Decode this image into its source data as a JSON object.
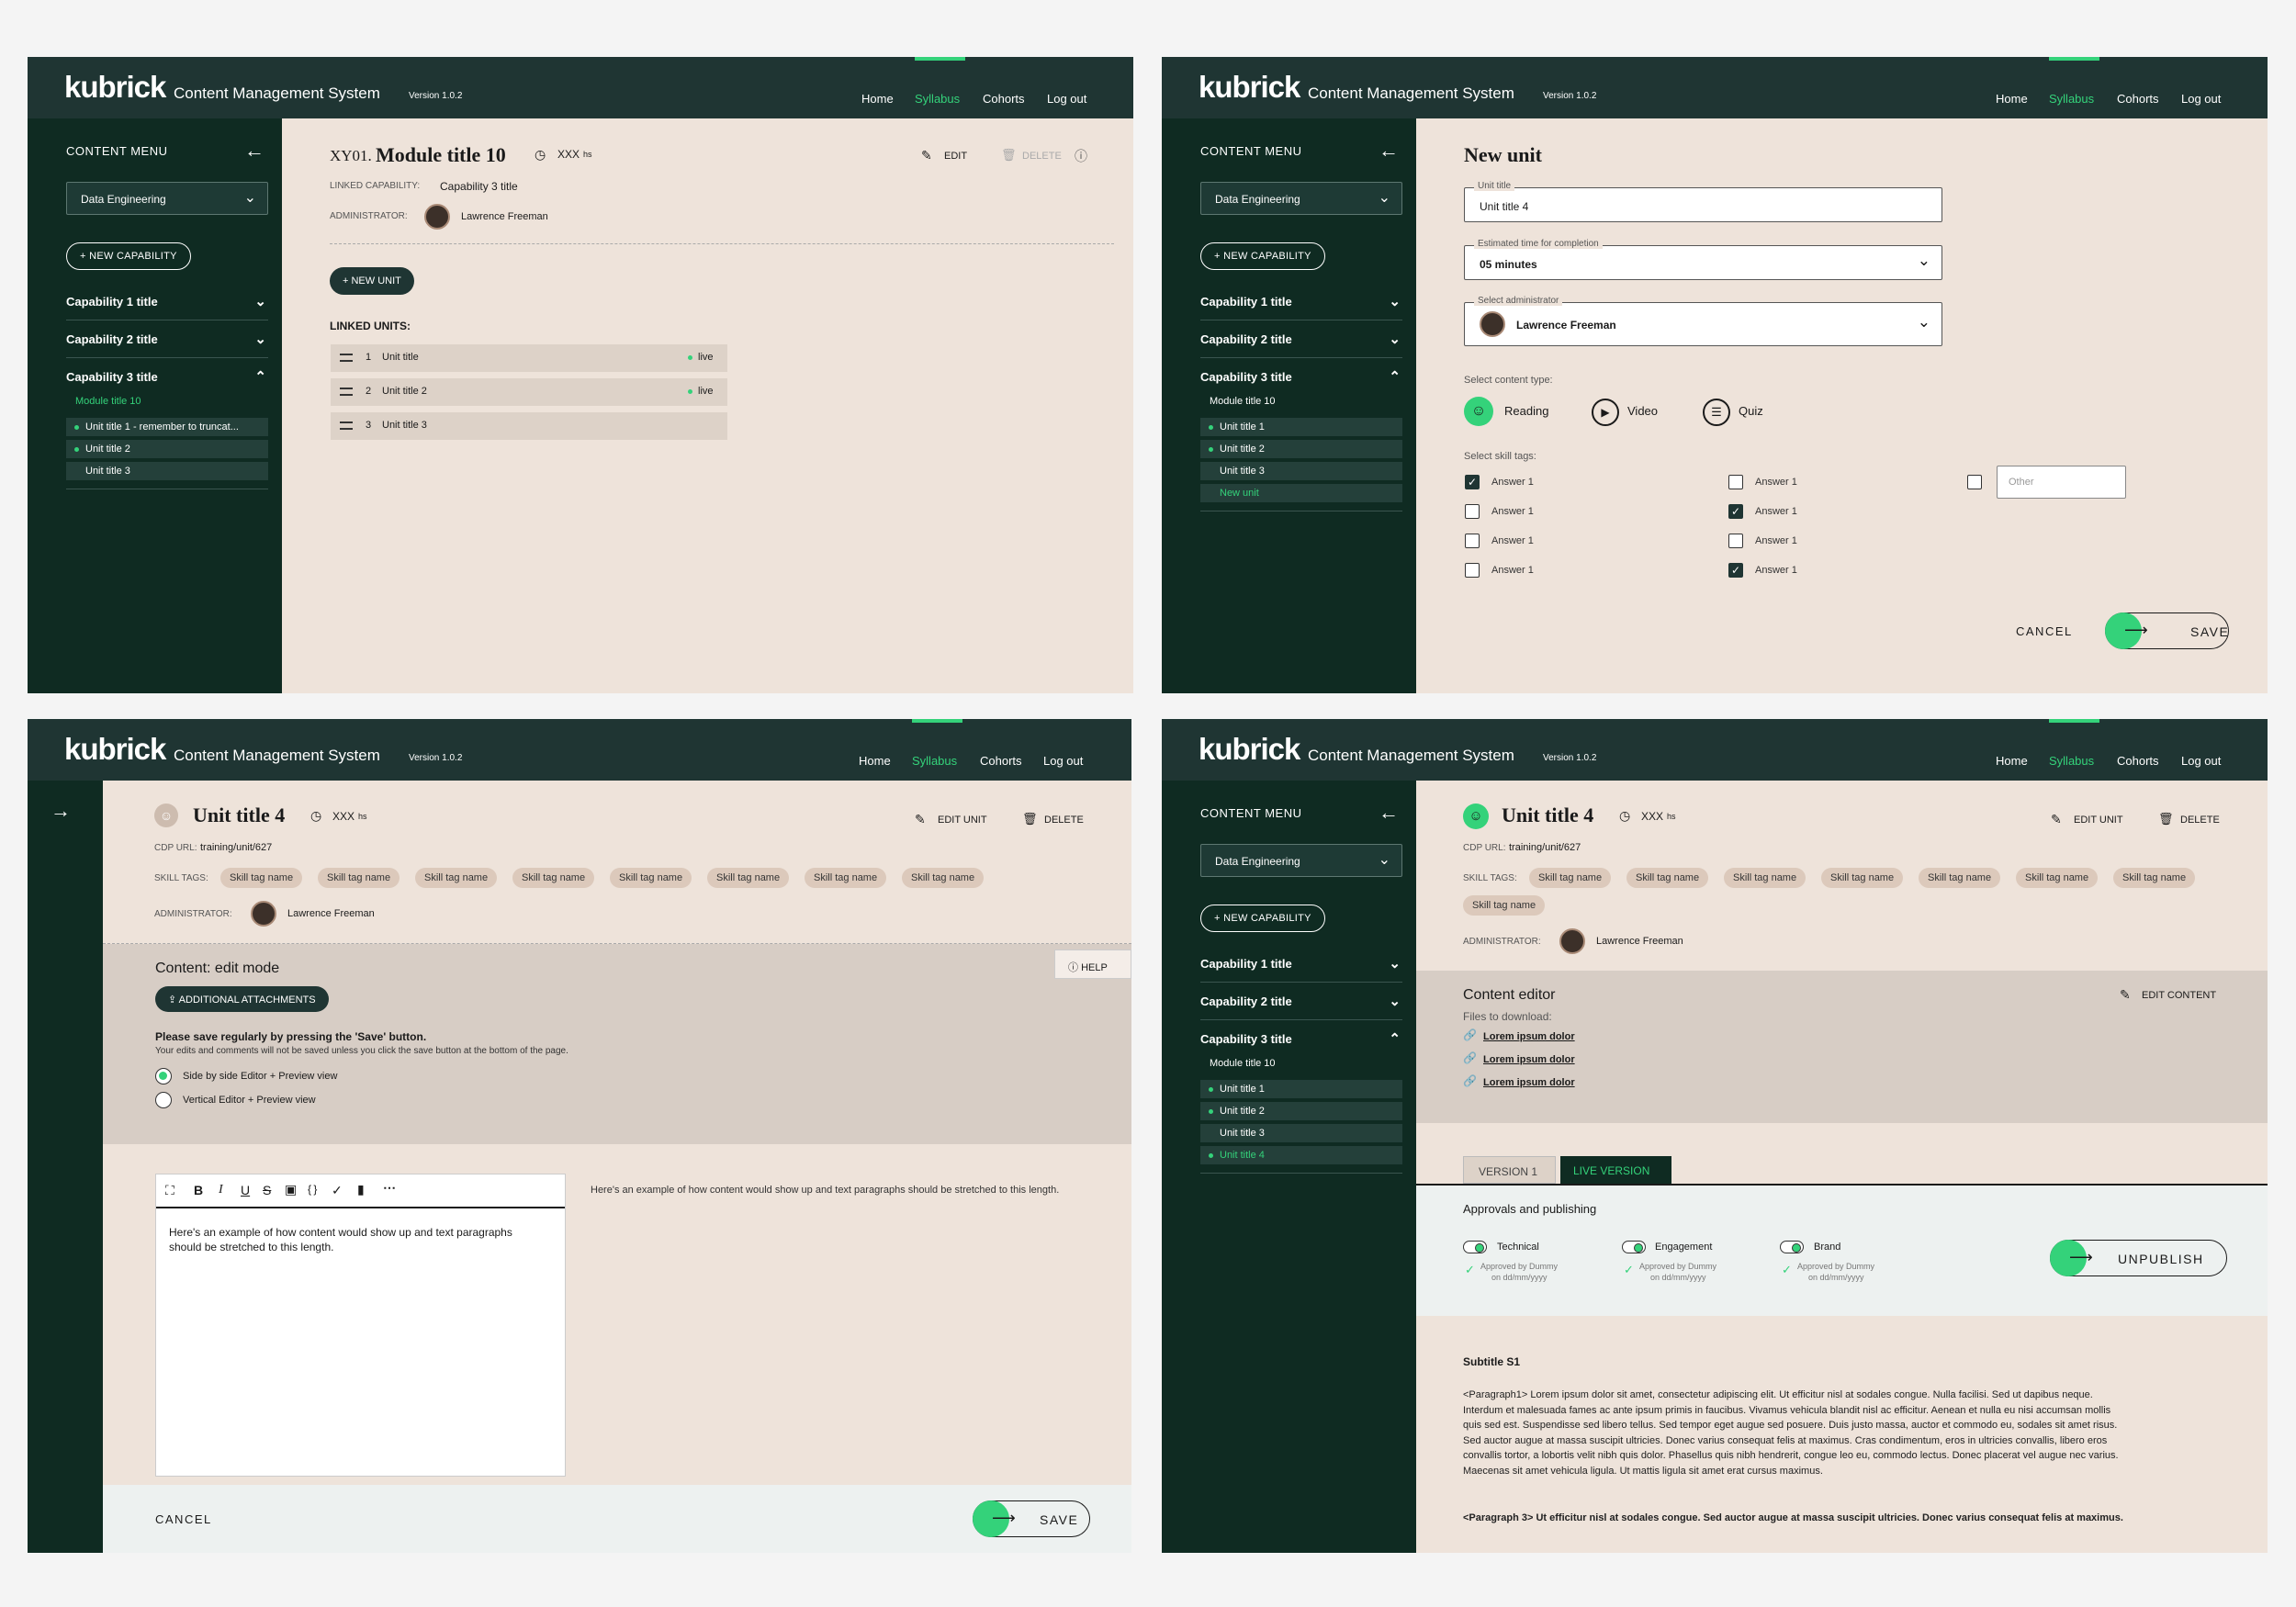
{
  "app": {
    "logo": "kubrick",
    "title": "Content Management System",
    "version": "Version 1.0.2",
    "nav": [
      "Home",
      "Syllabus",
      "Cohorts",
      "Log out"
    ],
    "accent": "#34d27a",
    "header_bg": "#1f3533",
    "sidebar_bg": "#0f2b22",
    "content_bg": "#eee3da"
  },
  "sidebar": {
    "menu_label": "CONTENT MENU",
    "dropdown_value": "Data Engineering",
    "new_capability": "NEW CAPABILITY",
    "capabilities": [
      "Capability 1 title",
      "Capability 2 title",
      "Capability 3 title"
    ]
  },
  "screen1": {
    "module_code": "XY01.",
    "module_title": "Module title 10",
    "duration": "XXX",
    "duration_unit": "hs",
    "edit": "EDIT",
    "delete": "DELETE",
    "linked_capability_label": "LINKED CAPABILITY:",
    "linked_capability": "Capability 3 title",
    "administrator_label": "ADMINISTRATOR:",
    "administrator": "Lawrence Freeman",
    "new_unit": "NEW UNIT",
    "linked_units_label": "LINKED UNITS:",
    "units": [
      {
        "num": "1",
        "title": "Unit title",
        "status": "live"
      },
      {
        "num": "2",
        "title": "Unit title 2",
        "status": "live"
      },
      {
        "num": "3",
        "title": "Unit title 3",
        "status": ""
      }
    ],
    "side_module": "Module title 10",
    "side_units": [
      "Unit title 1 - remember to truncat...",
      "Unit title 2",
      "Unit title 3"
    ]
  },
  "screen2": {
    "heading": "New unit",
    "unit_title_label": "Unit title",
    "unit_title_value": "Unit title 4",
    "time_label": "Estimated time for completion",
    "time_value": "05 minutes",
    "admin_label": "Select administrator",
    "admin_value": "Lawrence Freeman",
    "content_type_label": "Select content type:",
    "content_types": [
      "Reading",
      "Video",
      "Quiz"
    ],
    "skill_tags_label": "Select skill tags:",
    "answers_col1": [
      {
        "label": "Answer 1",
        "checked": true
      },
      {
        "label": "Answer 1",
        "checked": false
      },
      {
        "label": "Answer 1",
        "checked": false
      },
      {
        "label": "Answer 1",
        "checked": false
      }
    ],
    "answers_col2": [
      {
        "label": "Answer 1",
        "checked": false
      },
      {
        "label": "Answer 1",
        "checked": true
      },
      {
        "label": "Answer 1",
        "checked": false
      },
      {
        "label": "Answer 1",
        "checked": true
      }
    ],
    "other_placeholder": "Other",
    "cancel": "CANCEL",
    "save": "SAVE",
    "side_module": "Module title  10",
    "side_units": [
      "Unit title 1",
      "Unit title 2",
      "Unit title 3",
      "New unit"
    ]
  },
  "screen3": {
    "unit_title": "Unit title 4",
    "duration": "XXX",
    "duration_unit": "hs",
    "edit_unit": "EDIT UNIT",
    "delete": "DELETE",
    "cdp_label": "CDP URL:",
    "cdp_url": "training/unit/627",
    "skill_tags_label": "SKILL TAGS:",
    "skill_tags": [
      "Skill tag name",
      "Skill tag name",
      "Skill tag name",
      "Skill tag name",
      "Skill tag name",
      "Skill tag name",
      "Skill tag name",
      "Skill tag name"
    ],
    "administrator_label": "ADMINISTRATOR:",
    "administrator": "Lawrence Freeman",
    "help": "HELP",
    "content_mode": "Content: edit mode",
    "attachments": "ADDITIONAL ATTACHMENTS",
    "save_note": "Please save regularly by pressing the 'Save' button.",
    "save_sub": "Your edits and comments will not be saved unless you click the save button at the bottom of the page.",
    "view_options": [
      {
        "label": "Side by side Editor + Preview view",
        "selected": true
      },
      {
        "label": "Vertical Editor + Preview view",
        "selected": false
      }
    ],
    "editor_text": "Here's an example of how content would show up and text paragraphs should be stretched to this length.",
    "preview_text": "Here's an example of how content would show up and text paragraphs should be stretched to this length.",
    "cancel": "CANCEL",
    "save": "SAVE"
  },
  "screen4": {
    "unit_title": "Unit title 4",
    "duration": "XXX",
    "duration_unit": "hs",
    "edit_unit": "EDIT UNIT",
    "delete": "DELETE",
    "cdp_label": "CDP URL:",
    "cdp_url": "training/unit/627",
    "skill_tags_label": "SKILL TAGS:",
    "skill_tags": [
      "Skill tag name",
      "Skill tag name",
      "Skill tag name",
      "Skill tag name",
      "Skill tag name",
      "Skill tag name",
      "Skill tag name",
      "Skill tag name"
    ],
    "administrator_label": "ADMINISTRATOR:",
    "administrator": "Lawrence Freeman",
    "content_editor": "Content editor",
    "edit_content": "EDIT CONTENT",
    "files_label": "Files to download:",
    "files": [
      "Lorem ipsum dolor",
      "Lorem ipsum dolor",
      "Lorem ipsum dolor"
    ],
    "tabs": [
      "VERSION 1",
      "LIVE VERSION"
    ],
    "approvals_label": "Approvals and publishing",
    "approvals": [
      {
        "name": "Technical",
        "note1": "Approved by Dummy",
        "note2": "on dd/mm/yyyy"
      },
      {
        "name": "Engagement",
        "note1": "Approved by Dummy",
        "note2": "on dd/mm/yyyy"
      },
      {
        "name": "Brand",
        "note1": "Approved by Dummy",
        "note2": "on dd/mm/yyyy"
      }
    ],
    "unpublish": "UNPUBLISH",
    "subtitle": "Subtitle S1",
    "paragraph1": "<Paragraph1> Lorem ipsum dolor sit amet, consectetur adipiscing elit. Ut efficitur nisl at sodales congue. Nulla facilisi. Sed ut dapibus neque. Interdum et malesuada fames ac ante ipsum primis in faucibus. Vivamus vehicula blandit nisl ac efficitur. Aenean et nulla eu nisi accumsan mollis quis sed est. Suspendisse sed libero tellus. Sed tempor eget augue sed posuere. Duis justo massa, auctor et commodo eu, sodales sit amet risus. Sed auctor augue at massa suscipit ultricies. Donec varius consequat felis at maximus. Cras condimentum, eros in ultricies convallis, libero eros convallis tortor, a lobortis velit nibh quis dolor. Phasellus quis nibh hendrerit, congue leo eu, commodo lectus. Donec placerat vel augue nec varius. Maecenas sit amet vehicula ligula. Ut mattis ligula sit amet erat cursus maximus.",
    "paragraph3": "<Paragraph 3> Ut efficitur nisl at sodales congue. Sed auctor augue at massa suscipit ultricies. Donec varius consequat felis at maximus.",
    "side_module": "Module title 10",
    "side_units": [
      "Unit title 1",
      "Unit title 2",
      "Unit title 3",
      "Unit title 4"
    ]
  }
}
